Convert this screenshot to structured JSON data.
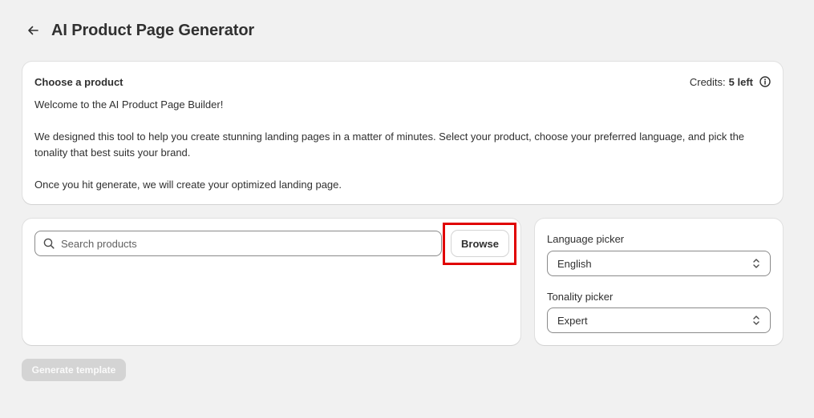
{
  "header": {
    "back_icon": "arrow-left-icon",
    "title": "AI Product Page Generator"
  },
  "intro": {
    "title": "Choose a product",
    "credits_label": "Credits:",
    "credits_value": "5 left",
    "info_icon": "info-icon",
    "paragraphs": [
      "Welcome to the AI Product Page Builder!",
      "We designed this tool to help you create stunning landing pages in a matter of minutes. Select your product, choose your preferred language, and pick the tonality that best suits your brand.",
      "Once you hit generate, we will create your optimized landing page."
    ]
  },
  "search": {
    "icon": "search-icon",
    "placeholder": "Search products",
    "value": "",
    "browse_label": "Browse"
  },
  "pickers": {
    "language": {
      "label": "Language picker",
      "selected": "English"
    },
    "tonality": {
      "label": "Tonality picker",
      "selected": "Expert"
    },
    "chevron_icon": "select-chevron-icon"
  },
  "generate": {
    "label": "Generate template",
    "disabled": true
  },
  "colors": {
    "background": "#f1f1f1",
    "card": "#ffffff",
    "text": "#303030",
    "highlight": "#e00000",
    "disabled_button": "#d4d4d4"
  }
}
